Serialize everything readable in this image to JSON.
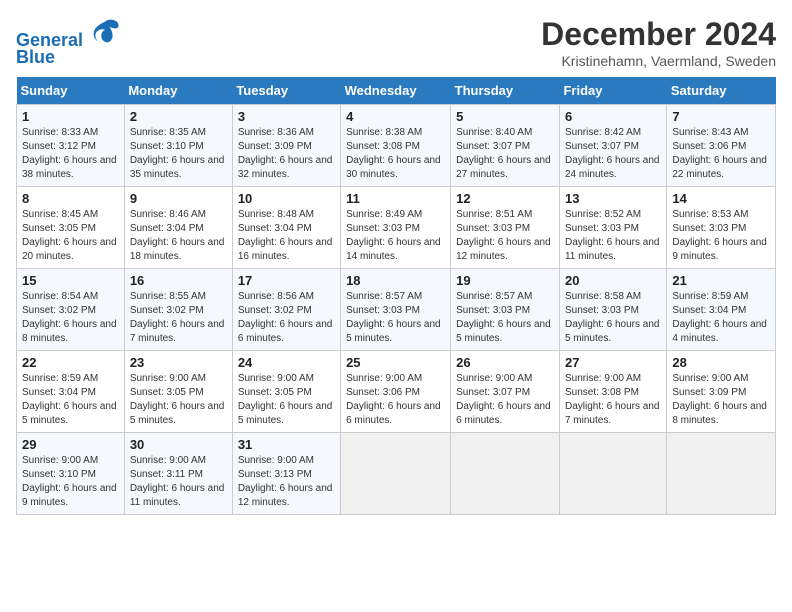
{
  "header": {
    "logo_line1": "General",
    "logo_line2": "Blue",
    "title": "December 2024",
    "subtitle": "Kristinehamn, Vaermland, Sweden"
  },
  "columns": [
    "Sunday",
    "Monday",
    "Tuesday",
    "Wednesday",
    "Thursday",
    "Friday",
    "Saturday"
  ],
  "weeks": [
    [
      {
        "day": "1",
        "sunrise": "Sunrise: 8:33 AM",
        "sunset": "Sunset: 3:12 PM",
        "daylight": "Daylight: 6 hours and 38 minutes."
      },
      {
        "day": "2",
        "sunrise": "Sunrise: 8:35 AM",
        "sunset": "Sunset: 3:10 PM",
        "daylight": "Daylight: 6 hours and 35 minutes."
      },
      {
        "day": "3",
        "sunrise": "Sunrise: 8:36 AM",
        "sunset": "Sunset: 3:09 PM",
        "daylight": "Daylight: 6 hours and 32 minutes."
      },
      {
        "day": "4",
        "sunrise": "Sunrise: 8:38 AM",
        "sunset": "Sunset: 3:08 PM",
        "daylight": "Daylight: 6 hours and 30 minutes."
      },
      {
        "day": "5",
        "sunrise": "Sunrise: 8:40 AM",
        "sunset": "Sunset: 3:07 PM",
        "daylight": "Daylight: 6 hours and 27 minutes."
      },
      {
        "day": "6",
        "sunrise": "Sunrise: 8:42 AM",
        "sunset": "Sunset: 3:07 PM",
        "daylight": "Daylight: 6 hours and 24 minutes."
      },
      {
        "day": "7",
        "sunrise": "Sunrise: 8:43 AM",
        "sunset": "Sunset: 3:06 PM",
        "daylight": "Daylight: 6 hours and 22 minutes."
      }
    ],
    [
      {
        "day": "8",
        "sunrise": "Sunrise: 8:45 AM",
        "sunset": "Sunset: 3:05 PM",
        "daylight": "Daylight: 6 hours and 20 minutes."
      },
      {
        "day": "9",
        "sunrise": "Sunrise: 8:46 AM",
        "sunset": "Sunset: 3:04 PM",
        "daylight": "Daylight: 6 hours and 18 minutes."
      },
      {
        "day": "10",
        "sunrise": "Sunrise: 8:48 AM",
        "sunset": "Sunset: 3:04 PM",
        "daylight": "Daylight: 6 hours and 16 minutes."
      },
      {
        "day": "11",
        "sunrise": "Sunrise: 8:49 AM",
        "sunset": "Sunset: 3:03 PM",
        "daylight": "Daylight: 6 hours and 14 minutes."
      },
      {
        "day": "12",
        "sunrise": "Sunrise: 8:51 AM",
        "sunset": "Sunset: 3:03 PM",
        "daylight": "Daylight: 6 hours and 12 minutes."
      },
      {
        "day": "13",
        "sunrise": "Sunrise: 8:52 AM",
        "sunset": "Sunset: 3:03 PM",
        "daylight": "Daylight: 6 hours and 11 minutes."
      },
      {
        "day": "14",
        "sunrise": "Sunrise: 8:53 AM",
        "sunset": "Sunset: 3:03 PM",
        "daylight": "Daylight: 6 hours and 9 minutes."
      }
    ],
    [
      {
        "day": "15",
        "sunrise": "Sunrise: 8:54 AM",
        "sunset": "Sunset: 3:02 PM",
        "daylight": "Daylight: 6 hours and 8 minutes."
      },
      {
        "day": "16",
        "sunrise": "Sunrise: 8:55 AM",
        "sunset": "Sunset: 3:02 PM",
        "daylight": "Daylight: 6 hours and 7 minutes."
      },
      {
        "day": "17",
        "sunrise": "Sunrise: 8:56 AM",
        "sunset": "Sunset: 3:02 PM",
        "daylight": "Daylight: 6 hours and 6 minutes."
      },
      {
        "day": "18",
        "sunrise": "Sunrise: 8:57 AM",
        "sunset": "Sunset: 3:03 PM",
        "daylight": "Daylight: 6 hours and 5 minutes."
      },
      {
        "day": "19",
        "sunrise": "Sunrise: 8:57 AM",
        "sunset": "Sunset: 3:03 PM",
        "daylight": "Daylight: 6 hours and 5 minutes."
      },
      {
        "day": "20",
        "sunrise": "Sunrise: 8:58 AM",
        "sunset": "Sunset: 3:03 PM",
        "daylight": "Daylight: 6 hours and 5 minutes."
      },
      {
        "day": "21",
        "sunrise": "Sunrise: 8:59 AM",
        "sunset": "Sunset: 3:04 PM",
        "daylight": "Daylight: 6 hours and 4 minutes."
      }
    ],
    [
      {
        "day": "22",
        "sunrise": "Sunrise: 8:59 AM",
        "sunset": "Sunset: 3:04 PM",
        "daylight": "Daylight: 6 hours and 5 minutes."
      },
      {
        "day": "23",
        "sunrise": "Sunrise: 9:00 AM",
        "sunset": "Sunset: 3:05 PM",
        "daylight": "Daylight: 6 hours and 5 minutes."
      },
      {
        "day": "24",
        "sunrise": "Sunrise: 9:00 AM",
        "sunset": "Sunset: 3:05 PM",
        "daylight": "Daylight: 6 hours and 5 minutes."
      },
      {
        "day": "25",
        "sunrise": "Sunrise: 9:00 AM",
        "sunset": "Sunset: 3:06 PM",
        "daylight": "Daylight: 6 hours and 6 minutes."
      },
      {
        "day": "26",
        "sunrise": "Sunrise: 9:00 AM",
        "sunset": "Sunset: 3:07 PM",
        "daylight": "Daylight: 6 hours and 6 minutes."
      },
      {
        "day": "27",
        "sunrise": "Sunrise: 9:00 AM",
        "sunset": "Sunset: 3:08 PM",
        "daylight": "Daylight: 6 hours and 7 minutes."
      },
      {
        "day": "28",
        "sunrise": "Sunrise: 9:00 AM",
        "sunset": "Sunset: 3:09 PM",
        "daylight": "Daylight: 6 hours and 8 minutes."
      }
    ],
    [
      {
        "day": "29",
        "sunrise": "Sunrise: 9:00 AM",
        "sunset": "Sunset: 3:10 PM",
        "daylight": "Daylight: 6 hours and 9 minutes."
      },
      {
        "day": "30",
        "sunrise": "Sunrise: 9:00 AM",
        "sunset": "Sunset: 3:11 PM",
        "daylight": "Daylight: 6 hours and 11 minutes."
      },
      {
        "day": "31",
        "sunrise": "Sunrise: 9:00 AM",
        "sunset": "Sunset: 3:13 PM",
        "daylight": "Daylight: 6 hours and 12 minutes."
      },
      null,
      null,
      null,
      null
    ]
  ]
}
